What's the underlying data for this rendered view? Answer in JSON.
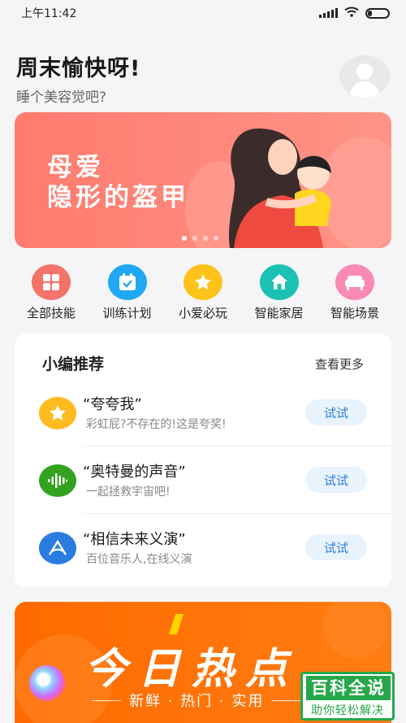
{
  "status_bar": {
    "time": "上午11:42"
  },
  "greeting": {
    "title": "周末愉快呀!",
    "subtitle": "睡个美容觉吧?"
  },
  "banner": {
    "line1": "母爱",
    "line2": "隐形的盔甲"
  },
  "quick_actions": [
    {
      "label": "全部技能",
      "icon": "grid-icon",
      "color": "#f4736a"
    },
    {
      "label": "训练计划",
      "icon": "calendar-icon",
      "color": "#21a8f2"
    },
    {
      "label": "小爱必玩",
      "icon": "star-icon",
      "color": "#ffc21a"
    },
    {
      "label": "智能家居",
      "icon": "home-icon",
      "color": "#1bc1b3"
    },
    {
      "label": "智能场景",
      "icon": "sofa-icon",
      "color": "#f98ab4"
    }
  ],
  "recommend": {
    "title": "小编推荐",
    "more": "查看更多",
    "items": [
      {
        "title": "“夸夸我”",
        "subtitle": "彩虹屁?不存在的!这是夸奖!",
        "button": "试试",
        "icon": "star-icon",
        "color": "#ffbb1f"
      },
      {
        "title": "“奥特曼的声音”",
        "subtitle": "一起拯救宇宙吧!",
        "button": "试试",
        "icon": "soundwave-icon",
        "color": "#33a31f"
      },
      {
        "title": "“相信未来义演”",
        "subtitle": "百位音乐人,在线义演",
        "button": "试试",
        "icon": "logo-icon",
        "color": "#2a7ce0"
      }
    ]
  },
  "hot": {
    "title": "今日热点",
    "subtitle": "新鲜 · 热门 · 实用"
  },
  "watermark": {
    "line1": "百科全说",
    "line2": "助你轻松解决"
  }
}
